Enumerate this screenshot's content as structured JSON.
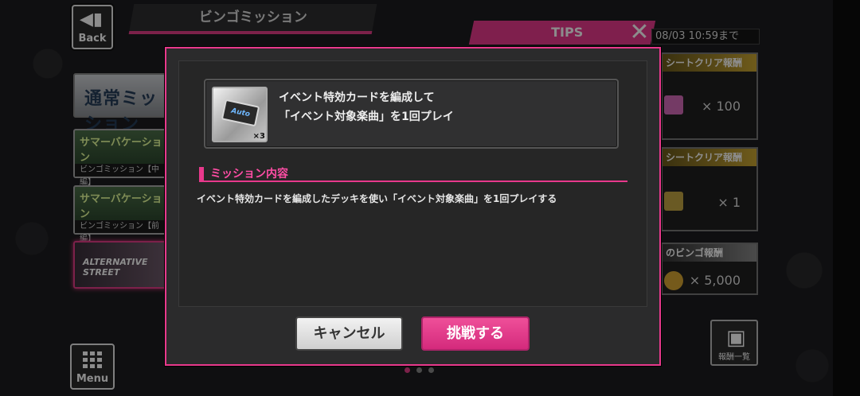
{
  "header": {
    "back_label": "Back",
    "title": "ビンゴミッション"
  },
  "tips": {
    "label": "TIPS",
    "close_glyph": "✕",
    "deadline": "08/03 10:59まで"
  },
  "left_list": {
    "normal": "通常ミッション",
    "events": [
      {
        "title": "サマーバケーション",
        "sub": "ビンゴミッション【中編】"
      },
      {
        "title": "サマーバケーション",
        "sub": "ビンゴミッション【前編】"
      }
    ],
    "alt": "ALTERNATIVE STREET"
  },
  "rewards": [
    {
      "header": "シートクリア報酬",
      "value": "× 100"
    },
    {
      "header": "シートクリア報酬",
      "value": "× 1"
    },
    {
      "header": "のビンゴ報酬",
      "value": "× 5,000"
    }
  ],
  "rewards_list_label": "報酬一覧",
  "menu_label": "Menu",
  "modal": {
    "card": {
      "icon_text": "Auto",
      "multiplier": "×3",
      "description": "イベント特効カードを編成して\n「イベント対象楽曲」を1回プレイ"
    },
    "section_title": "ミッション内容",
    "section_body": "イベント特効カードを編成したデッキを使い「イベント対象楽曲」を1回プレイする",
    "cancel_label": "キャンセル",
    "challenge_label": "挑戦する"
  },
  "colors": {
    "accent": "#e8398c",
    "background": "#1d1d1f"
  }
}
